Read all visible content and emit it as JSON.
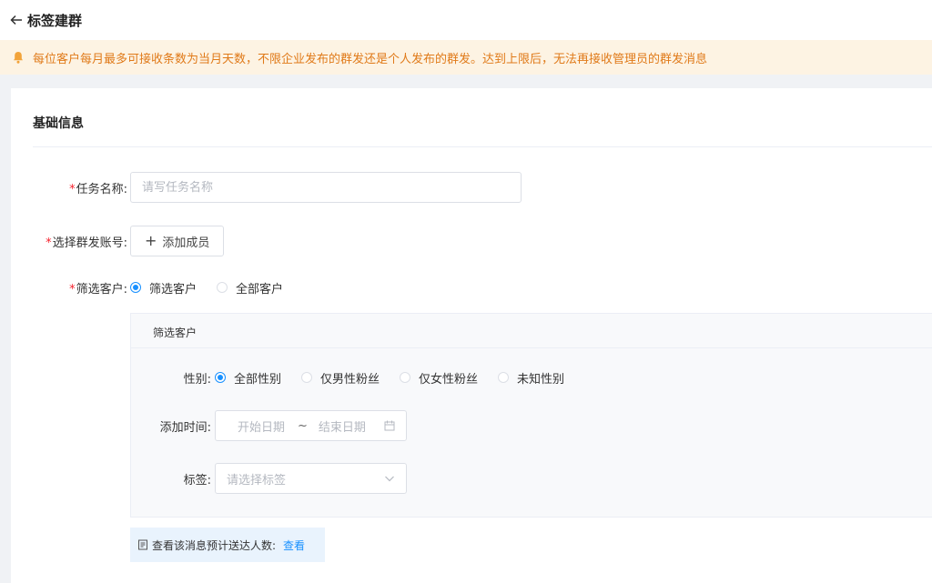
{
  "header": {
    "title": "标签建群"
  },
  "notice": {
    "text": "每位客户每月最多可接收条数为当月天数，不限企业发布的群发还是个人发布的群发。达到上限后，无法再接收管理员的群发消息"
  },
  "section": {
    "title": "基础信息"
  },
  "form": {
    "required_mark": "*",
    "task_name": {
      "label": "任务名称:",
      "placeholder": "请写任务名称",
      "value": ""
    },
    "account": {
      "label": "选择群发账号:",
      "button_label": "添加成员",
      "button_icon": "plus-icon"
    },
    "customers": {
      "label": "筛选客户:",
      "options": [
        "筛选客户",
        "全部客户"
      ],
      "selected": "筛选客户"
    }
  },
  "filter": {
    "title": "筛选客户",
    "gender": {
      "label": "性别:",
      "options": [
        "全部性别",
        "仅男性粉丝",
        "仅女性粉丝",
        "未知性别"
      ],
      "selected": "全部性别"
    },
    "add_time": {
      "label": "添加时间:",
      "start_placeholder": "开始日期",
      "separator": "~",
      "end_placeholder": "结束日期"
    },
    "tags": {
      "label": "标签:",
      "placeholder": "请选择标签"
    }
  },
  "estimate": {
    "text": "查看该消息预计送达人数:",
    "link": "查看"
  },
  "colors": {
    "accent": "#1890ff",
    "warning": "#e07a19",
    "required": "#f5222d"
  }
}
